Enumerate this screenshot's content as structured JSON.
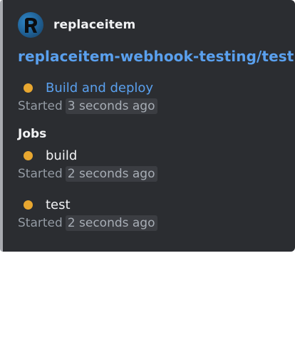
{
  "embed": {
    "accent_color": "#a9abb0",
    "author": {
      "name": "replaceitem",
      "avatar_icon": "avatar-r-icon"
    },
    "title": "replaceitem-webhook-testing/test",
    "run": {
      "status_color": "#e8a730",
      "label": "Build and deploy",
      "started_label": "Started",
      "started_time": "3 seconds ago"
    },
    "jobs_heading": "Jobs",
    "jobs": [
      {
        "name": "build",
        "status_color": "#e8a730",
        "started_label": "Started",
        "started_time": "2 seconds ago"
      },
      {
        "name": "test",
        "status_color": "#e8a730",
        "started_label": "Started",
        "started_time": "2 seconds ago"
      }
    ]
  }
}
